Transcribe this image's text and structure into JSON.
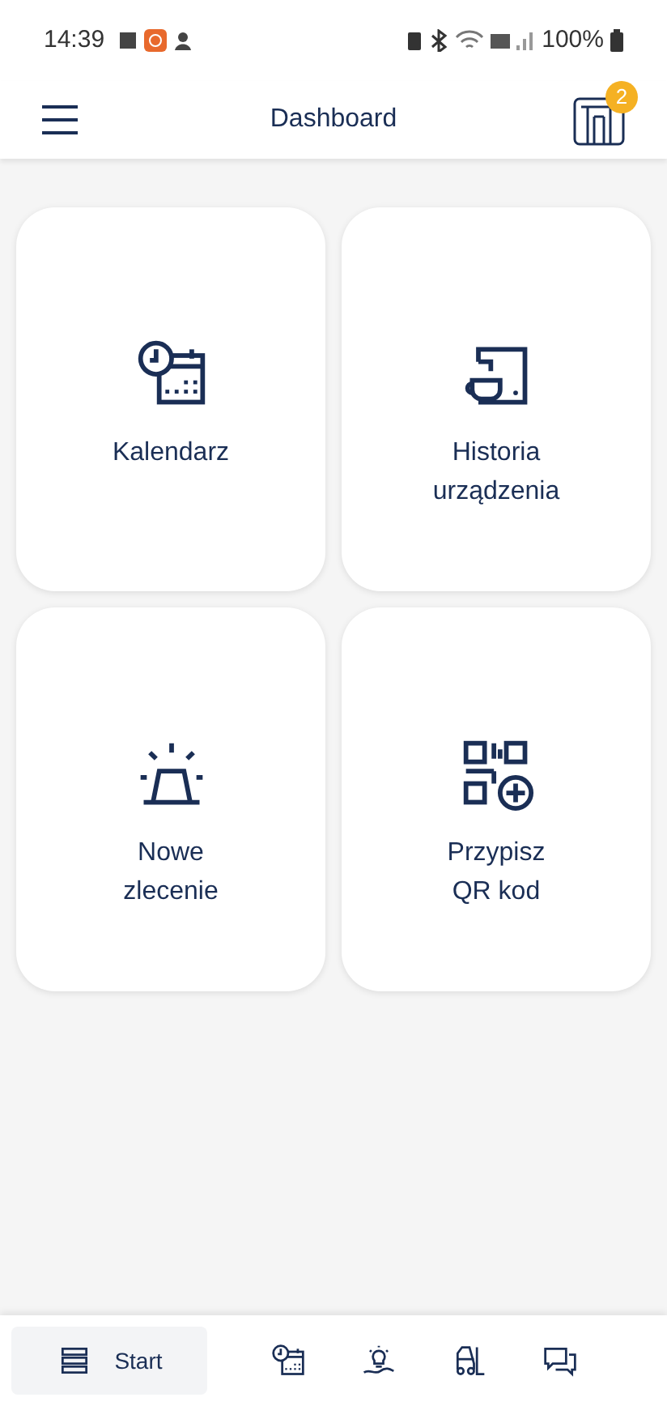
{
  "status_bar": {
    "time": "14:39",
    "battery": "100%"
  },
  "header": {
    "title": "Dashboard",
    "badge": "2"
  },
  "tiles": [
    {
      "kind": "calendar",
      "label": "Kalendarz"
    },
    {
      "kind": "machine",
      "label": "Historia\nurządzenia"
    },
    {
      "kind": "alarm",
      "label": "Nowe\nzlecenie"
    },
    {
      "kind": "qr",
      "label": "Przypisz\nQR kod"
    }
  ],
  "nav": [
    {
      "kind": "list",
      "label": "Start",
      "selected": true
    },
    {
      "kind": "calendar",
      "selected": false
    },
    {
      "kind": "idea",
      "selected": false
    },
    {
      "kind": "forklift",
      "selected": false
    },
    {
      "kind": "chat",
      "selected": false
    }
  ]
}
